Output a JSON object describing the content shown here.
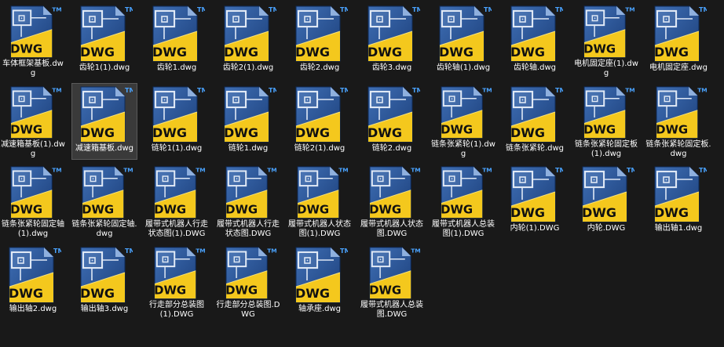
{
  "icon": {
    "name": "dwg-file-icon",
    "badge_text": "DWG",
    "trademark": "TM",
    "colors": {
      "doc_blue_dark": "#1c3f7a",
      "doc_blue_light": "#3f6fb5",
      "wedge_yellow": "#f4c81d",
      "label_black": "#111111"
    }
  },
  "background": "#191919",
  "files": [
    {
      "name": "车体框架基板.dwg"
    },
    {
      "name": "齿轮1(1).dwg"
    },
    {
      "name": "齿轮1.dwg"
    },
    {
      "name": "齿轮2(1).dwg"
    },
    {
      "name": "齿轮2.dwg"
    },
    {
      "name": "齿轮3.dwg"
    },
    {
      "name": "齿轮轴(1).dwg"
    },
    {
      "name": "齿轮轴.dwg"
    },
    {
      "name": "电机固定座(1).dwg"
    },
    {
      "name": "电机固定座.dwg"
    },
    {
      "name": "减速箱基板(1).dwg"
    },
    {
      "name": "减速箱基板.dwg",
      "selected": true
    },
    {
      "name": "链轮1(1).dwg"
    },
    {
      "name": "链轮1.dwg"
    },
    {
      "name": "链轮2(1).dwg"
    },
    {
      "name": "链轮2.dwg"
    },
    {
      "name": "链条张紧轮(1).dwg"
    },
    {
      "name": "链条张紧轮.dwg"
    },
    {
      "name": "链条张紧轮固定板(1).dwg"
    },
    {
      "name": "链条张紧轮固定板.dwg"
    },
    {
      "name": "链条张紧轮固定轴(1).dwg"
    },
    {
      "name": "链条张紧轮固定轴.dwg"
    },
    {
      "name": "履带式机器人行走状态图(1).DWG"
    },
    {
      "name": "履带式机器人行走状态图.DWG"
    },
    {
      "name": "履带式机器人状态图(1).DWG"
    },
    {
      "name": "履带式机器人状态图.DWG"
    },
    {
      "name": "履带式机器人总装图(1).DWG"
    },
    {
      "name": "内轮(1).DWG"
    },
    {
      "name": "内轮.DWG"
    },
    {
      "name": "输出轴1.dwg"
    },
    {
      "name": "输出轴2.dwg"
    },
    {
      "name": "输出轴3.dwg"
    },
    {
      "name": "行走部分总装图(1).DWG"
    },
    {
      "name": "行走部分总装图.DWG"
    },
    {
      "name": "轴承座.dwg"
    },
    {
      "name": "履带式机器人总装图.DWG"
    }
  ]
}
